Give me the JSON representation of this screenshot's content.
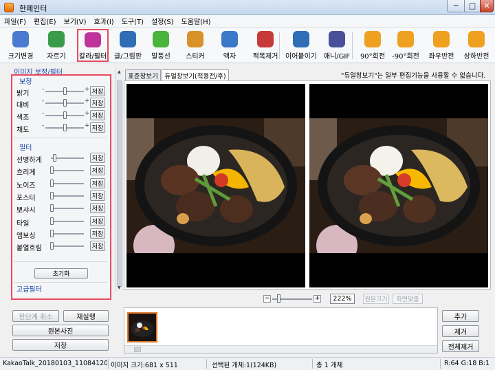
{
  "window": {
    "title": "한페인터"
  },
  "menu": [
    "파일(F)",
    "편집(E)",
    "보기(V)",
    "효과(I)",
    "도구(T)",
    "설정(S)",
    "도움말(H)"
  ],
  "toolbar": [
    {
      "label": "크기변경",
      "icon": "resize-icon",
      "color": "#4a7bd0"
    },
    {
      "label": "자르기",
      "icon": "crop-icon",
      "color": "#3a9c4a"
    },
    {
      "label": "칼라/필터",
      "icon": "color-filter-icon",
      "color": "#c0339a"
    },
    {
      "label": "글/그림판",
      "icon": "text-paint-icon",
      "color": "#2f6db5"
    },
    {
      "label": "말풍선",
      "icon": "speech-bubble-icon",
      "color": "#48b43c"
    },
    {
      "label": "스티커",
      "icon": "sticker-icon",
      "color": "#d8922a"
    },
    {
      "label": "액자",
      "icon": "frame-icon",
      "color": "#3c78c8"
    },
    {
      "label": "적목제거",
      "icon": "red-eye-icon",
      "color": "#c83a3a"
    },
    {
      "label": "이어붙이기",
      "icon": "merge-icon",
      "color": "#2f6db5"
    },
    {
      "label": "애니/GIF",
      "icon": "animation-icon",
      "color": "#4a4f9a"
    },
    {
      "label": "90°회전",
      "icon": "rotate-cw-icon",
      "color": "#f0a020"
    },
    {
      "label": "-90°회전",
      "icon": "rotate-ccw-icon",
      "color": "#f0a020"
    },
    {
      "label": "좌우반전",
      "icon": "flip-h-icon",
      "color": "#f0a020"
    },
    {
      "label": "상하반전",
      "icon": "flip-v-icon",
      "color": "#f0a020"
    }
  ],
  "panel": {
    "title": "이미지 보정/필터",
    "correction_header": "보정",
    "correction": [
      {
        "label": "밝기",
        "value": 0.5
      },
      {
        "label": "대비",
        "value": 0.5
      },
      {
        "label": "색조",
        "value": 0.5
      },
      {
        "label": "채도",
        "value": 0.5
      }
    ],
    "filter_header": "필터",
    "filters": [
      {
        "label": "선명하게",
        "value": 0.08
      },
      {
        "label": "흐리게",
        "value": 0
      },
      {
        "label": "노이즈",
        "value": 0
      },
      {
        "label": "포스터",
        "value": 0
      },
      {
        "label": "뽀샤시",
        "value": 0
      },
      {
        "label": "타일",
        "value": 0
      },
      {
        "label": "엠보싱",
        "value": 0
      },
      {
        "label": "붙열흐림",
        "value": 0
      }
    ],
    "save_label": "저장",
    "reset_label": "초기화",
    "advanced_header": "고급필터"
  },
  "tabs": [
    "표준창보기",
    "듀얼창보기(적용전/후)"
  ],
  "tab_note": "\"듀얼창보기\"는 일부 편집기능을 사용할 수 없습니다.",
  "zoom": {
    "value": "222%",
    "original_size": "원본크기",
    "fit_screen": "화면맞춤"
  },
  "left_buttons": {
    "undo": "한단계 취소",
    "redo": "재실행",
    "original": "원본사진",
    "save": "저장"
  },
  "right_buttons": {
    "add": "추가",
    "remove": "제거",
    "remove_all": "전체제거"
  },
  "status": {
    "filename": "KakaoTalk_20180103_110841207.jpg",
    "size": "이미지 크기:681 x 511",
    "selected": "선택된 개체:1(124KB)",
    "total": "총 1 개체",
    "rgb": "R:64 G:18 B:1"
  }
}
